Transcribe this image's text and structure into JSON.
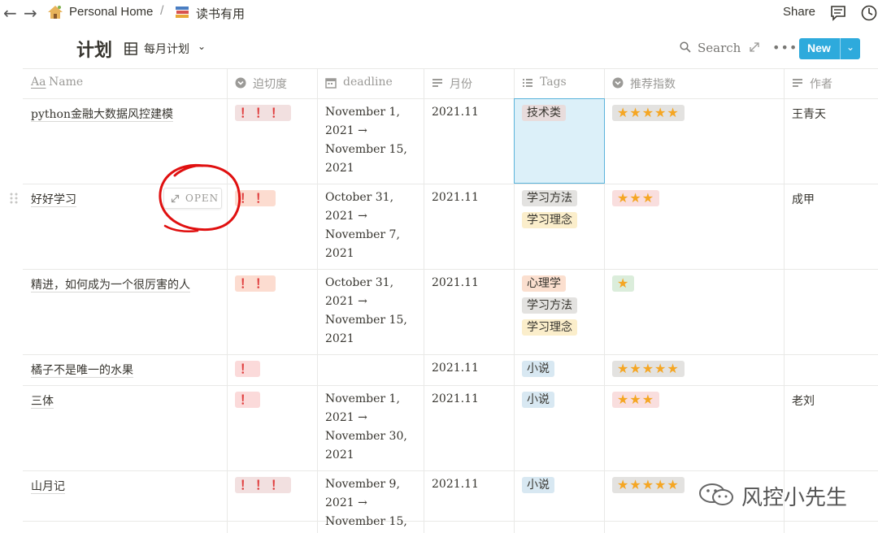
{
  "topbar": {
    "back": "←",
    "forward": "→",
    "crumb1": "Personal Home",
    "separator": "/",
    "crumb2": "读书有用",
    "share": "Share"
  },
  "database": {
    "title": "计划",
    "view_name": "每月计划",
    "search_label": "Search",
    "more": "•••",
    "new_label": "New"
  },
  "columns": [
    {
      "label": "Name",
      "icon": "aa-text-icon"
    },
    {
      "label": "迫切度",
      "icon": "select-icon"
    },
    {
      "label": "deadline",
      "icon": "calendar-icon"
    },
    {
      "label": "月份",
      "icon": "text-lines-icon"
    },
    {
      "label": "Tags",
      "icon": "list-icon"
    },
    {
      "label": "推荐指数",
      "icon": "select-icon"
    },
    {
      "label": "作者",
      "icon": "text-lines-icon"
    }
  ],
  "column_prefix": "Aa",
  "open_button": "OPEN",
  "rows": [
    {
      "name": "python金融大数据风控建模",
      "urgency": "！！！",
      "deadline": [
        "November 1,",
        "2021 →",
        "November 15,",
        "2021"
      ],
      "month": "2021.11",
      "tags": [
        "技术类"
      ],
      "rating": "★★★★★",
      "author": "王青天"
    },
    {
      "name": "好好学习",
      "urgency": "！！",
      "deadline": [
        "October 31,",
        "2021 →",
        "November 7,",
        "2021"
      ],
      "month": "2021.11",
      "tags": [
        "学习方法",
        "学习理念"
      ],
      "rating": "★★★",
      "author": "成甲"
    },
    {
      "name": "精进，如何成为一个很厉害的人",
      "urgency": "！！",
      "deadline": [
        "October 31,",
        "2021 →",
        "November 15,",
        "2021"
      ],
      "month": "2021.11",
      "tags": [
        "心理学",
        "学习方法",
        "学习理念"
      ],
      "rating": "★",
      "author": ""
    },
    {
      "name": "橘子不是唯一的水果",
      "urgency": "！",
      "deadline": [],
      "month": "2021.11",
      "tags": [
        "小说"
      ],
      "rating": "★★★★★",
      "author": ""
    },
    {
      "name": "三体",
      "urgency": "！",
      "deadline": [
        "November 1,",
        "2021 →",
        "November 30,",
        "2021"
      ],
      "month": "2021.11",
      "tags": [
        "小说"
      ],
      "rating": "★★★",
      "author": "老刘"
    },
    {
      "name": "山月记",
      "urgency": "！！！",
      "deadline": [
        "November 9,",
        "2021 →",
        "November 15,"
      ],
      "month": "2021.11",
      "tags": [
        "小说"
      ],
      "rating": "★★★★★",
      "author": ""
    }
  ],
  "colors": {
    "tag_tech": "#e8dcdc",
    "tag_gray": "#e3e2e0",
    "tag_yellow": "#fbeecb",
    "tag_orange": "#fbdfcf",
    "tag_blue": "#d8e8f2",
    "urgency_bg_3": "#f2e0e0",
    "urgency_bg_2": "#fcdcd0",
    "urgency_bg_1": "#fbdada",
    "stars_bg_5": "#e3e2e0",
    "stars_bg_3": "#f9dede",
    "stars_bg_1": "#dbeddb",
    "new_button": "#2eaadc",
    "annotation_circle": "#e01010"
  },
  "watermark": {
    "text": "风控小先生",
    "icon": "wechat-icon"
  }
}
